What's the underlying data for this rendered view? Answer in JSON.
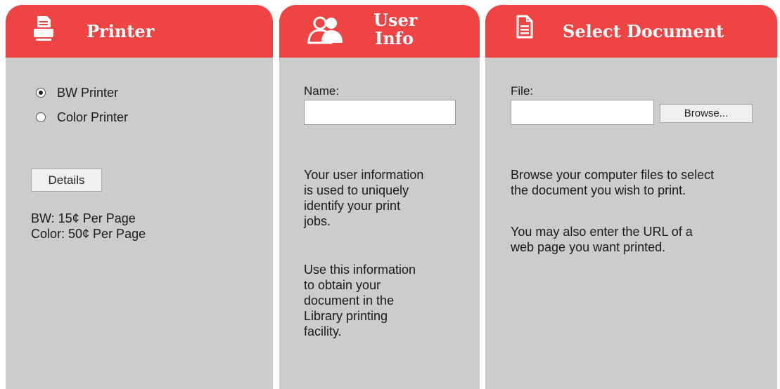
{
  "printer_panel": {
    "title": "Printer",
    "icon": "printer-icon",
    "options": [
      {
        "label": "BW Printer",
        "checked": true
      },
      {
        "label": "Color Printer",
        "checked": false
      }
    ],
    "details_label": "Details",
    "prices": [
      "BW: 15¢ Per Page",
      "Color: 50¢ Per Page"
    ]
  },
  "user_panel": {
    "title_line1": "User",
    "title_line2": "Info",
    "icon": "users-icon",
    "name_label": "Name:",
    "name_value": "",
    "info_lines_1": [
      "Your user information",
      "is used to uniquely",
      "identify your print",
      "jobs."
    ],
    "info_lines_2": [
      "Use this information",
      "to obtain your",
      "document in the",
      "Library printing",
      "facility."
    ]
  },
  "document_panel": {
    "title": "Select Document",
    "icon": "document-icon",
    "file_label": "File:",
    "file_value": "",
    "browse_label": "Browse...",
    "info_lines_1": [
      "Browse your computer files to select",
      "the document you wish to print."
    ],
    "info_lines_2": [
      "You may also enter the URL of a",
      "web page you want printed."
    ]
  },
  "colors": {
    "header": "#ee4444",
    "panel": "#cccccc",
    "header_text": "#ffffff"
  }
}
